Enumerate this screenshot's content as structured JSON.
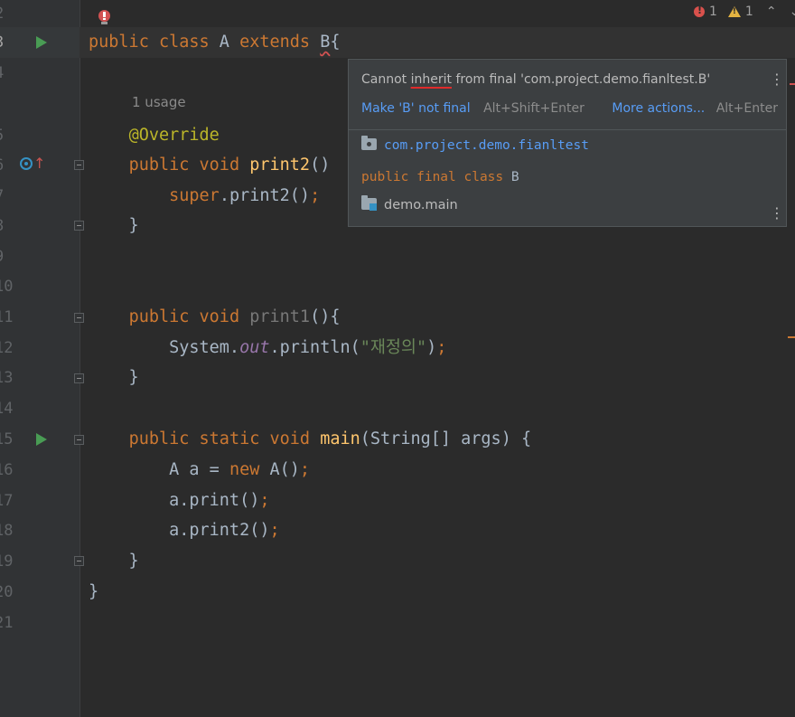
{
  "editor": {
    "lines": [
      {
        "num": "2"
      },
      {
        "num": "3",
        "tokens": [
          [
            "kw",
            "public "
          ],
          [
            "kw",
            "class "
          ],
          [
            "p",
            "A "
          ],
          [
            "kw",
            "extends "
          ],
          [
            "squig",
            "B"
          ],
          [
            "p",
            "{"
          ]
        ]
      },
      {
        "num": "4"
      },
      {
        "num": "5",
        "tokens": [
          [
            "p",
            "    "
          ],
          [
            "ann",
            "@Override"
          ]
        ]
      },
      {
        "num": "6",
        "tokens": [
          [
            "p",
            "    "
          ],
          [
            "kw",
            "public "
          ],
          [
            "kw",
            "void "
          ],
          [
            "fn",
            "print2"
          ],
          [
            "p",
            "()"
          ]
        ]
      },
      {
        "num": "7",
        "tokens": [
          [
            "p",
            "        "
          ],
          [
            "kw",
            "super"
          ],
          [
            "p",
            ".print2()"
          ],
          [
            "semi",
            ";"
          ]
        ]
      },
      {
        "num": "8",
        "tokens": [
          [
            "p",
            "    }"
          ]
        ]
      },
      {
        "num": "9"
      },
      {
        "num": "10"
      },
      {
        "num": "11",
        "tokens": [
          [
            "p",
            "    "
          ],
          [
            "kw",
            "public "
          ],
          [
            "kw",
            "void "
          ],
          [
            "gray",
            "print1"
          ],
          [
            "p",
            "(){"
          ]
        ]
      },
      {
        "num": "12",
        "tokens": [
          [
            "p",
            "        System."
          ],
          [
            "field",
            "out"
          ],
          [
            "p",
            ".println("
          ],
          [
            "str",
            "\"재정의\""
          ],
          [
            "p",
            ")"
          ],
          [
            "semi",
            ";"
          ]
        ]
      },
      {
        "num": "13",
        "tokens": [
          [
            "p",
            "    }"
          ]
        ]
      },
      {
        "num": "14"
      },
      {
        "num": "15",
        "tokens": [
          [
            "p",
            "    "
          ],
          [
            "kw",
            "public "
          ],
          [
            "kw",
            "static "
          ],
          [
            "kw",
            "void "
          ],
          [
            "fn",
            "main"
          ],
          [
            "p",
            "(String[] args) {"
          ]
        ]
      },
      {
        "num": "16",
        "tokens": [
          [
            "p",
            "        A a = "
          ],
          [
            "kw",
            "new "
          ],
          [
            "p",
            "A()"
          ],
          [
            "semi",
            ";"
          ]
        ]
      },
      {
        "num": "17",
        "tokens": [
          [
            "p",
            "        a.print()"
          ],
          [
            "semi",
            ";"
          ]
        ]
      },
      {
        "num": "18",
        "tokens": [
          [
            "p",
            "        a.print2()"
          ],
          [
            "semi",
            ";"
          ]
        ]
      },
      {
        "num": "19",
        "tokens": [
          [
            "p",
            "    }"
          ]
        ]
      },
      {
        "num": "20",
        "tokens": [
          [
            "p",
            "}"
          ]
        ]
      },
      {
        "num": "21"
      }
    ],
    "usage_hint": "1 usage"
  },
  "status": {
    "errors": "1",
    "warnings": "1"
  },
  "popup": {
    "message_before": "Cannot ",
    "message_underlined": "inherit",
    "message_after": " from final 'com.project.demo.fianltest.B'",
    "fix_action": "Make 'B' not final",
    "fix_shortcut": "Alt+Shift+Enter",
    "more_actions": "More actions...",
    "more_shortcut": "Alt+Enter",
    "package": "com.project.demo.fianltest",
    "declaration_modifiers": "public final class ",
    "declaration_name": "B",
    "module": "demo.main"
  },
  "colors": {
    "background": "#2b2b2b",
    "keyword": "#cc7832",
    "error": "#d25252",
    "link": "#589df6"
  },
  "icons": [
    "error-bulb-icon",
    "run-icon",
    "override-icon",
    "fold-icon",
    "error-icon",
    "warning-icon",
    "chevron-up-icon",
    "chevron-down-icon",
    "package-icon",
    "module-icon",
    "more-options-icon"
  ]
}
